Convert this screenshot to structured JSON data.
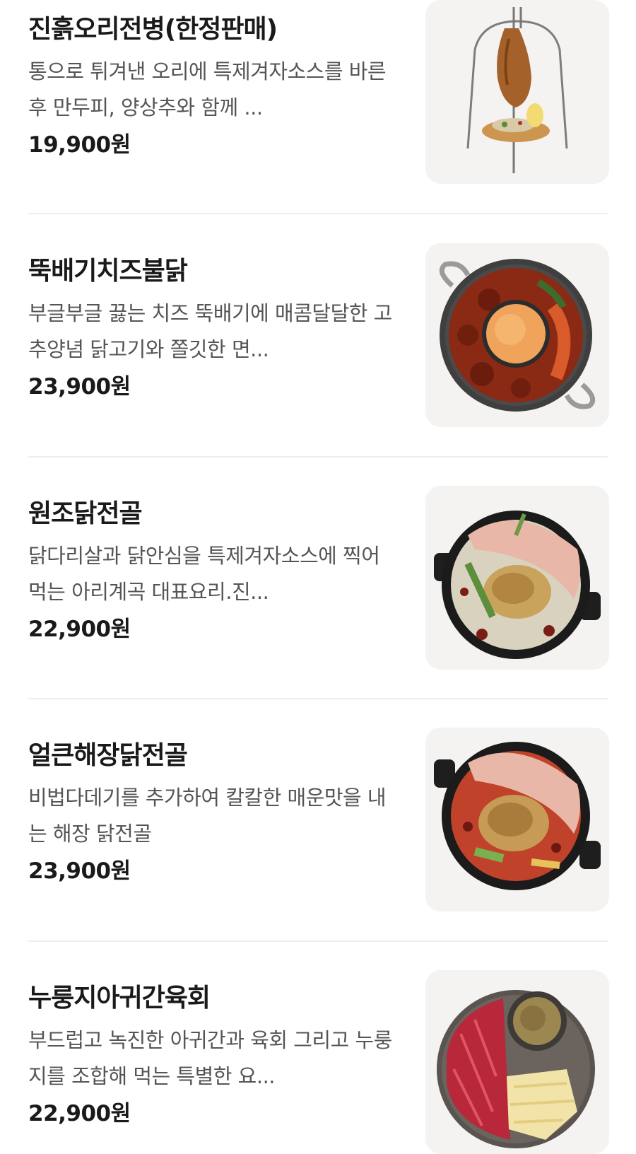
{
  "menu": {
    "items": [
      {
        "name": "진흙오리전병(한정판매)",
        "description": "통으로 튀겨낸 오리에 특제겨자소스를 바른 후 만두피, 양상추와 함께 ...",
        "price": "19,900원",
        "image": "roast-duck-hanging-photo"
      },
      {
        "name": "뚝배기치즈불닭",
        "description": "부글부글 끓는 치즈 뚝배기에 매콤달달한 고추양념 닭고기와 쫄깃한 면...",
        "price": "23,900원",
        "image": "cheese-fire-chicken-pan-photo"
      },
      {
        "name": "원조닭전골",
        "description": "닭다리살과 닭안심을 특제겨자소스에 찍어먹는 아리계곡 대표요리.진...",
        "price": "22,900원",
        "image": "chicken-hotpot-photo"
      },
      {
        "name": "얼큰해장닭전골",
        "description": "비법다데기를 추가하여 칼칼한 매운맛을 내는 해장 닭전골",
        "price": "23,900원",
        "image": "spicy-chicken-hotpot-photo"
      },
      {
        "name": "누룽지아귀간육회",
        "description": "부드럽고 녹진한 아귀간과 육회 그리고 누룽지를 조합해 먹는 특별한 요...",
        "price": "22,900원",
        "image": "monkfish-liver-yukhoe-photo"
      }
    ]
  }
}
